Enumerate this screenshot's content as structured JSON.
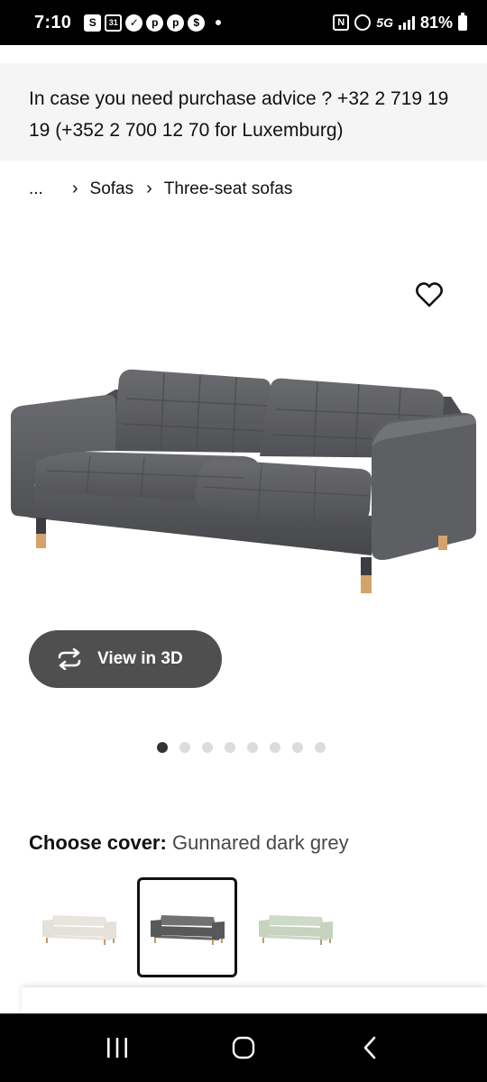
{
  "status_bar": {
    "time": "7:10",
    "left_icons": [
      "S",
      "31"
    ],
    "network": "5G",
    "battery": "81%"
  },
  "banner": {
    "text": "In case you need purchase advice ? +32 2 719 19 19 (+352 2 700 12 70 for Luxemburg)"
  },
  "breadcrumb": {
    "ellipsis": "...",
    "items": [
      "Sofas",
      "Three-seat sofas"
    ]
  },
  "product": {
    "image_icon": "sofa-image",
    "favorite_icon": "heart-outline-icon"
  },
  "view3d": {
    "label": "View in 3D",
    "icon": "rotate-icon"
  },
  "carousel": {
    "total": 8,
    "active_index": 0
  },
  "cover": {
    "title": "Choose cover:",
    "value": "Gunnared dark grey",
    "options": [
      {
        "color": "#e4e1d8",
        "selected": false
      },
      {
        "color": "#57585a",
        "selected": true
      },
      {
        "color": "#c7d3bf",
        "selected": false
      }
    ]
  },
  "colors": {
    "status_bar": "#000000",
    "banner_bg": "#f5f5f5",
    "button_bg": "#4f4f4f",
    "dot_active": "#333333",
    "dot_inactive": "#dcdcdc",
    "sofa_fabric": "#5d5e61",
    "sofa_leg_wood": "#d2a46b"
  }
}
